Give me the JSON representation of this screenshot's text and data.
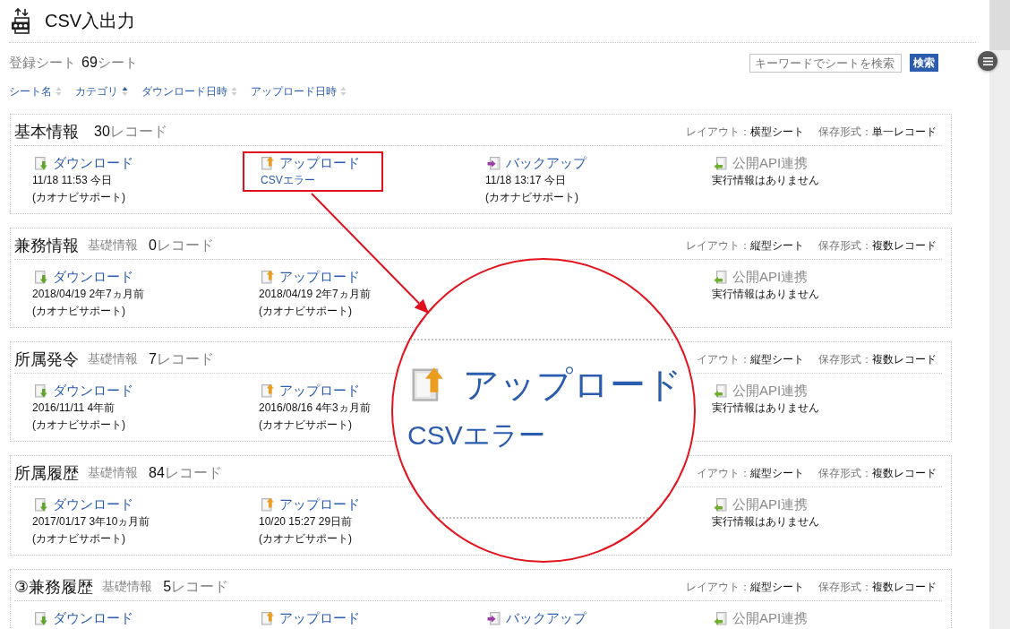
{
  "header": {
    "title": "CSV入出力"
  },
  "summary": {
    "label": "登録シート",
    "count": "69",
    "unit": "シート"
  },
  "search": {
    "placeholder": "キーワードでシートを検索",
    "button": "検索"
  },
  "sort_columns": [
    {
      "label": "シート名",
      "sorted": false
    },
    {
      "label": "カテゴリ",
      "sorted": true
    },
    {
      "label": "ダウンロード日時",
      "sorted": false
    },
    {
      "label": "アップロード日時",
      "sorted": false
    }
  ],
  "sheets": [
    {
      "name": "基本情報",
      "count": "30",
      "unit": "レコード",
      "layout_label": "レイアウト：",
      "layout": "横型シート",
      "format_label": "保存形式：",
      "format": "単一レコード",
      "actions": [
        {
          "kind": "download",
          "label": "ダウンロード",
          "disabled": false,
          "highlighted": false,
          "lines": [
            "11/18 11:53 今日",
            "(カオナビサポート)"
          ]
        },
        {
          "kind": "upload",
          "label": "アップロード",
          "disabled": false,
          "highlighted": true,
          "error_link": "CSVエラー"
        },
        {
          "kind": "backup",
          "label": "バックアップ",
          "disabled": false,
          "highlighted": false,
          "lines": [
            "11/18 13:17 今日",
            "(カオナビサポート)"
          ]
        },
        {
          "kind": "api",
          "label": "公開API連携",
          "disabled": true,
          "highlighted": false,
          "lines": [
            "実行情報はありません"
          ]
        }
      ]
    },
    {
      "name": "兼務情報",
      "category": "基礎情報",
      "count": "0",
      "unit": "レコード",
      "layout_label": "レイアウト：",
      "layout": "縦型シート",
      "format_label": "保存形式：",
      "format": "複数レコード",
      "actions": [
        {
          "kind": "download",
          "label": "ダウンロード",
          "disabled": false,
          "highlighted": false,
          "lines": [
            "2018/04/19 2年7ヵ月前",
            "(カオナビサポート)"
          ]
        },
        {
          "kind": "upload",
          "label": "アップロード",
          "disabled": false,
          "highlighted": false,
          "lines": [
            "2018/04/19 2年7ヵ月前",
            "(カオナビサポート)"
          ]
        },
        {
          "kind": "api",
          "label": "公開API連携",
          "disabled": true,
          "highlighted": false,
          "lines": [
            "実行情報はありません"
          ]
        }
      ]
    },
    {
      "name": "所属発令",
      "category": "基礎情報",
      "count": "7",
      "unit": "レコード",
      "layout_label": "イアウト：",
      "layout": "縦型シート",
      "format_label": "保存形式：",
      "format": "複数レコード",
      "actions": [
        {
          "kind": "download",
          "label": "ダウンロード",
          "disabled": false,
          "highlighted": false,
          "lines": [
            "2016/11/11 4年前",
            "(カオナビサポート)"
          ]
        },
        {
          "kind": "upload",
          "label": "アップロード",
          "disabled": false,
          "highlighted": false,
          "lines": [
            "2016/08/16 4年3ヵ月前",
            "(カオナビサポート)"
          ]
        },
        {
          "kind": "api",
          "label": "公開API連携",
          "disabled": true,
          "highlighted": false,
          "lines": [
            "実行情報はありません"
          ]
        }
      ]
    },
    {
      "name": "所属履歴",
      "category": "基礎情報",
      "count": "84",
      "unit": "レコード",
      "layout_label": "イアウト：",
      "layout": "縦型シート",
      "format_label": "保存形式：",
      "format": "複数レコード",
      "actions": [
        {
          "kind": "download",
          "label": "ダウンロード",
          "disabled": false,
          "highlighted": false,
          "lines": [
            "2017/01/17 3年10ヵ月前",
            "(カオナビサポート)"
          ]
        },
        {
          "kind": "upload",
          "label": "アップロード",
          "disabled": false,
          "highlighted": false,
          "lines": [
            "10/20 15:27 29日前",
            "(カオナビサポート)"
          ]
        },
        {
          "kind": "api",
          "label": "公開API連携",
          "disabled": true,
          "highlighted": false,
          "lines": [
            "実行情報はありません"
          ]
        }
      ]
    },
    {
      "name": "③兼務履歴",
      "category": "基礎情報",
      "count": "5",
      "unit": "レコード",
      "layout_label": "レイアウト：",
      "layout": "縦型シート",
      "format_label": "保存形式：",
      "format": "複数レコード",
      "actions": [
        {
          "kind": "download",
          "label": "ダウンロード",
          "disabled": false,
          "highlighted": false
        },
        {
          "kind": "upload",
          "label": "アップロード",
          "disabled": false,
          "highlighted": false
        },
        {
          "kind": "backup",
          "label": "バックアップ",
          "disabled": false,
          "highlighted": false
        },
        {
          "kind": "api",
          "label": "公開API連携",
          "disabled": true,
          "highlighted": false
        }
      ]
    }
  ],
  "magnifier": {
    "label": "アップロード",
    "error_link": "CSVエラー"
  }
}
